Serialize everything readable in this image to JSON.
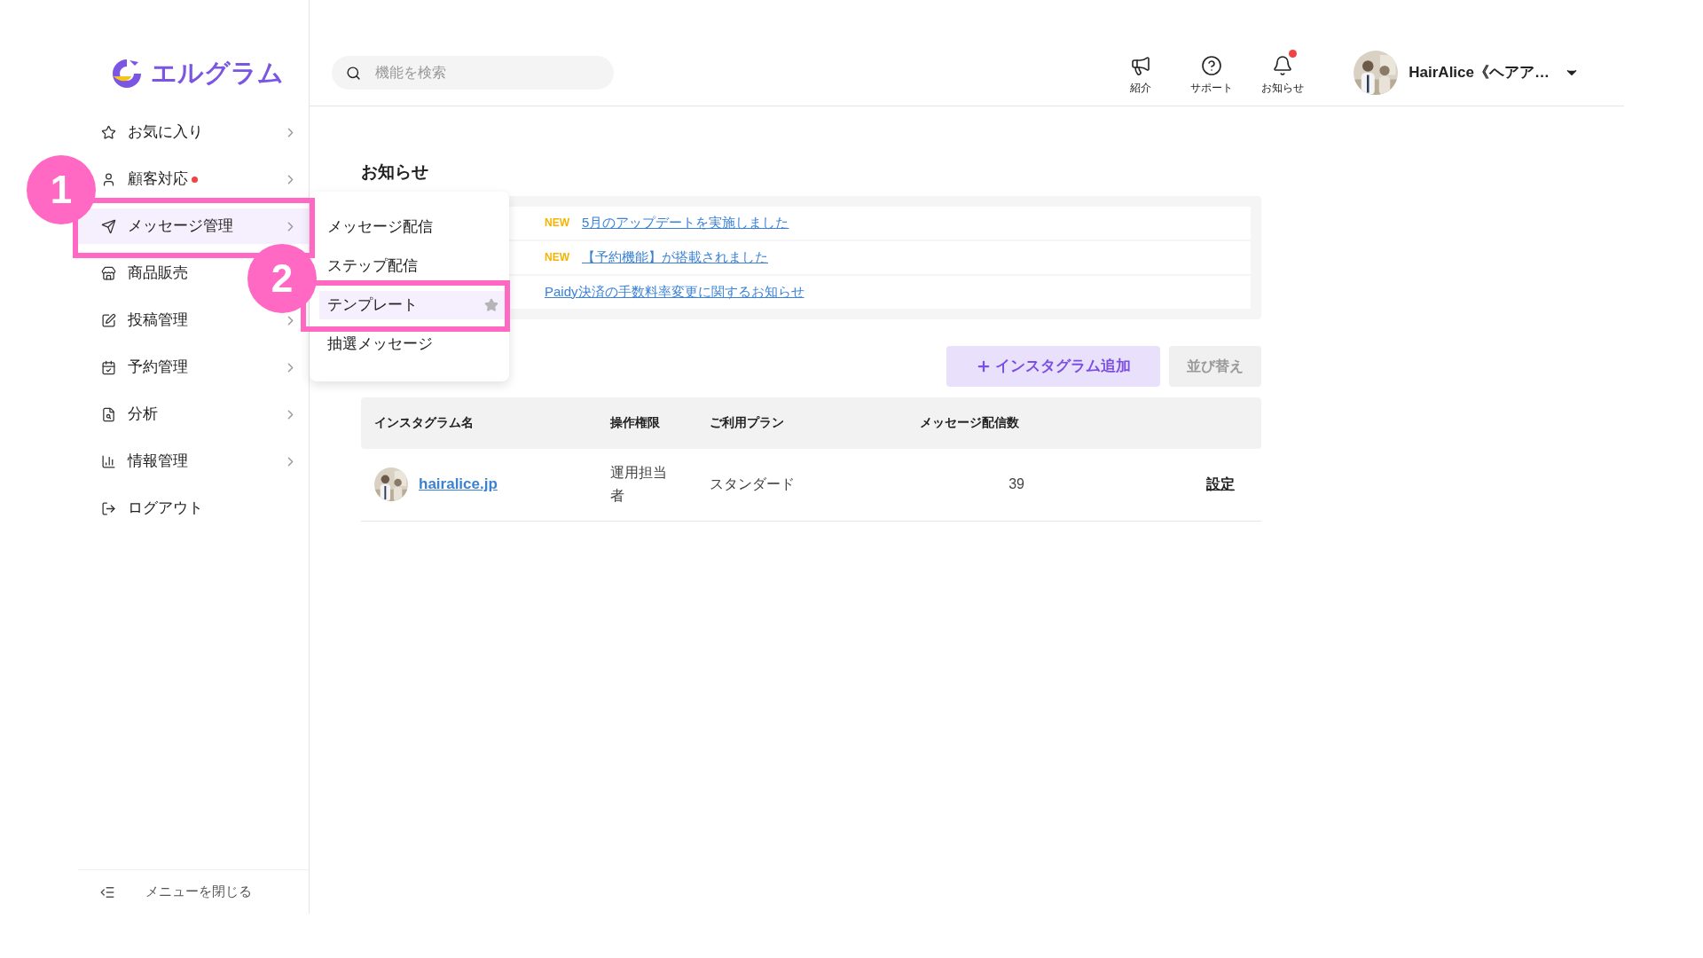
{
  "logo": {
    "text": "エルグラム"
  },
  "search": {
    "placeholder": "機能を検索"
  },
  "header_actions": [
    {
      "label": "紹介",
      "unread": false
    },
    {
      "label": "サポート",
      "unread": false
    },
    {
      "label": "お知らせ",
      "unread": true
    }
  ],
  "user": {
    "name": "HairAlice《ヘアア…"
  },
  "sidebar": {
    "items": [
      {
        "label": "お気に入り",
        "selected": false,
        "unread": false,
        "has_submenu": true
      },
      {
        "label": "顧客対応",
        "selected": false,
        "unread": true,
        "has_submenu": true
      },
      {
        "label": "メッセージ管理",
        "selected": true,
        "unread": false,
        "has_submenu": true
      },
      {
        "label": "商品販売",
        "selected": false,
        "unread": false,
        "has_submenu": false
      },
      {
        "label": "投稿管理",
        "selected": false,
        "unread": false,
        "has_submenu": true
      },
      {
        "label": "予約管理",
        "selected": false,
        "unread": false,
        "has_submenu": true
      },
      {
        "label": "分析",
        "selected": false,
        "unread": false,
        "has_submenu": true
      },
      {
        "label": "情報管理",
        "selected": false,
        "unread": false,
        "has_submenu": true
      },
      {
        "label": "ログアウト",
        "selected": false,
        "unread": false,
        "has_submenu": false
      }
    ],
    "footer": "メニューを閉じる"
  },
  "submenu": {
    "items": [
      {
        "label": "メッセージ配信",
        "selected": false
      },
      {
        "label": "ステップ配信",
        "selected": false
      },
      {
        "label": "テンプレート",
        "selected": true
      },
      {
        "label": "抽選メッセージ",
        "selected": false
      }
    ]
  },
  "step_badges": [
    {
      "label": "1"
    },
    {
      "label": "2"
    }
  ],
  "notices": {
    "title": "お知らせ",
    "items": [
      {
        "text": "5月のアップデートを実施しました",
        "is_new": true,
        "badge": "NEW"
      },
      {
        "text": "【予約機能】が搭載されました",
        "is_new": true,
        "badge": "NEW"
      },
      {
        "text": "Paidy決済の手数料率変更に関するお知らせ",
        "is_new": false
      }
    ]
  },
  "buttons": {
    "add": "インスタグラム追加",
    "sort": "並び替え"
  },
  "table": {
    "columns": [
      "インスタグラム名",
      "操作権限",
      "ご利用プラン",
      "メッセージ配信数"
    ],
    "rows": [
      {
        "name": "hairalice.jp",
        "role": "運用担当者",
        "plan": "スタンダード",
        "count": "39",
        "action": "設定"
      }
    ]
  }
}
